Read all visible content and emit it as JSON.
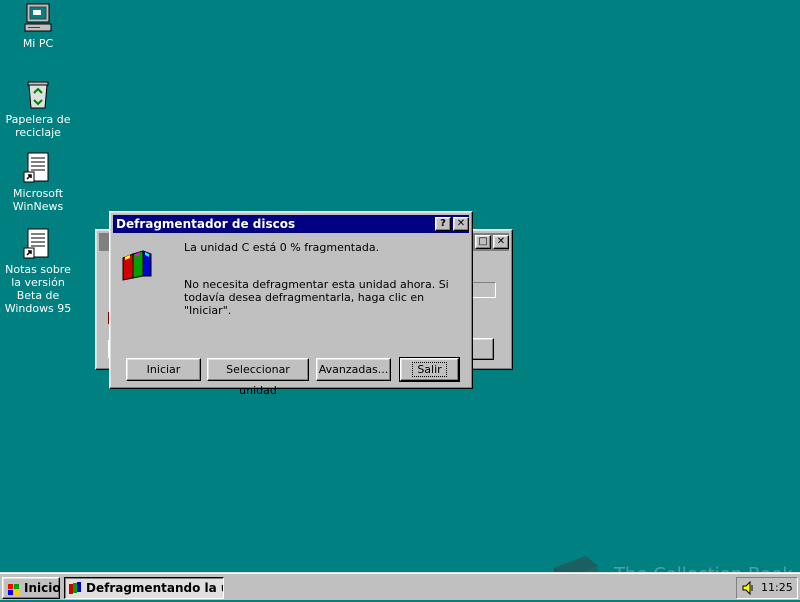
{
  "desktop": {
    "icons": [
      {
        "label": "Mi PC",
        "icon": "my-computer-icon"
      },
      {
        "label": "Papelera de reciclaje",
        "icon": "recycle-bin-icon"
      },
      {
        "label": "Microsoft WinNews",
        "icon": "document-shortcut-icon"
      },
      {
        "label": "Notas sobre la versión Beta de Windows 95",
        "icon": "document-shortcut-icon"
      }
    ],
    "background_color": "#008080"
  },
  "dialog": {
    "title": "Defragmentador de discos",
    "status_line": "La unidad C está 0 % fragmentada.",
    "message": "No necesita defragmentar esta unidad ahora. Si todavía desea defragmentarla, haga clic en \"Iniciar\".",
    "buttons": {
      "start": "Iniciar",
      "select_drive": "Seleccionar unidad",
      "advanced": "Avanzadas...",
      "exit": "Salir"
    },
    "title_buttons": {
      "help": "?",
      "close": "✕"
    },
    "icon": "defrag-app-icon"
  },
  "background_window": {
    "title_buttons": {
      "maximize": "□",
      "close": "✕"
    }
  },
  "taskbar": {
    "start_label": "Inicio",
    "task_label": "Defragmentando la u...",
    "clock": "11:25",
    "tray_icon": "speaker-icon"
  },
  "watermark": {
    "text": "The Collection Book",
    "icon": "book-icon"
  },
  "colors": {
    "active_title": "#000080",
    "inactive_title": "#808080",
    "face": "#c0c0c0"
  }
}
